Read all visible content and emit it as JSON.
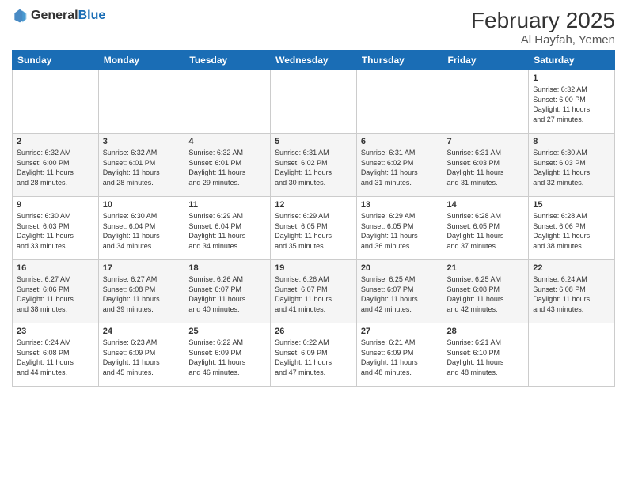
{
  "logo": {
    "text_general": "General",
    "text_blue": "Blue"
  },
  "header": {
    "month": "February 2025",
    "location": "Al Hayfah, Yemen"
  },
  "weekdays": [
    "Sunday",
    "Monday",
    "Tuesday",
    "Wednesday",
    "Thursday",
    "Friday",
    "Saturday"
  ],
  "weeks": [
    [
      {
        "day": "",
        "info": ""
      },
      {
        "day": "",
        "info": ""
      },
      {
        "day": "",
        "info": ""
      },
      {
        "day": "",
        "info": ""
      },
      {
        "day": "",
        "info": ""
      },
      {
        "day": "",
        "info": ""
      },
      {
        "day": "1",
        "info": "Sunrise: 6:32 AM\nSunset: 6:00 PM\nDaylight: 11 hours\nand 27 minutes."
      }
    ],
    [
      {
        "day": "2",
        "info": "Sunrise: 6:32 AM\nSunset: 6:00 PM\nDaylight: 11 hours\nand 28 minutes."
      },
      {
        "day": "3",
        "info": "Sunrise: 6:32 AM\nSunset: 6:01 PM\nDaylight: 11 hours\nand 28 minutes."
      },
      {
        "day": "4",
        "info": "Sunrise: 6:32 AM\nSunset: 6:01 PM\nDaylight: 11 hours\nand 29 minutes."
      },
      {
        "day": "5",
        "info": "Sunrise: 6:31 AM\nSunset: 6:02 PM\nDaylight: 11 hours\nand 30 minutes."
      },
      {
        "day": "6",
        "info": "Sunrise: 6:31 AM\nSunset: 6:02 PM\nDaylight: 11 hours\nand 31 minutes."
      },
      {
        "day": "7",
        "info": "Sunrise: 6:31 AM\nSunset: 6:03 PM\nDaylight: 11 hours\nand 31 minutes."
      },
      {
        "day": "8",
        "info": "Sunrise: 6:30 AM\nSunset: 6:03 PM\nDaylight: 11 hours\nand 32 minutes."
      }
    ],
    [
      {
        "day": "9",
        "info": "Sunrise: 6:30 AM\nSunset: 6:03 PM\nDaylight: 11 hours\nand 33 minutes."
      },
      {
        "day": "10",
        "info": "Sunrise: 6:30 AM\nSunset: 6:04 PM\nDaylight: 11 hours\nand 34 minutes."
      },
      {
        "day": "11",
        "info": "Sunrise: 6:29 AM\nSunset: 6:04 PM\nDaylight: 11 hours\nand 34 minutes."
      },
      {
        "day": "12",
        "info": "Sunrise: 6:29 AM\nSunset: 6:05 PM\nDaylight: 11 hours\nand 35 minutes."
      },
      {
        "day": "13",
        "info": "Sunrise: 6:29 AM\nSunset: 6:05 PM\nDaylight: 11 hours\nand 36 minutes."
      },
      {
        "day": "14",
        "info": "Sunrise: 6:28 AM\nSunset: 6:05 PM\nDaylight: 11 hours\nand 37 minutes."
      },
      {
        "day": "15",
        "info": "Sunrise: 6:28 AM\nSunset: 6:06 PM\nDaylight: 11 hours\nand 38 minutes."
      }
    ],
    [
      {
        "day": "16",
        "info": "Sunrise: 6:27 AM\nSunset: 6:06 PM\nDaylight: 11 hours\nand 38 minutes."
      },
      {
        "day": "17",
        "info": "Sunrise: 6:27 AM\nSunset: 6:08 PM\nDaylight: 11 hours\nand 39 minutes."
      },
      {
        "day": "18",
        "info": "Sunrise: 6:26 AM\nSunset: 6:07 PM\nDaylight: 11 hours\nand 40 minutes."
      },
      {
        "day": "19",
        "info": "Sunrise: 6:26 AM\nSunset: 6:07 PM\nDaylight: 11 hours\nand 41 minutes."
      },
      {
        "day": "20",
        "info": "Sunrise: 6:25 AM\nSunset: 6:07 PM\nDaylight: 11 hours\nand 42 minutes."
      },
      {
        "day": "21",
        "info": "Sunrise: 6:25 AM\nSunset: 6:08 PM\nDaylight: 11 hours\nand 42 minutes."
      },
      {
        "day": "22",
        "info": "Sunrise: 6:24 AM\nSunset: 6:08 PM\nDaylight: 11 hours\nand 43 minutes."
      }
    ],
    [
      {
        "day": "23",
        "info": "Sunrise: 6:24 AM\nSunset: 6:08 PM\nDaylight: 11 hours\nand 44 minutes."
      },
      {
        "day": "24",
        "info": "Sunrise: 6:23 AM\nSunset: 6:09 PM\nDaylight: 11 hours\nand 45 minutes."
      },
      {
        "day": "25",
        "info": "Sunrise: 6:22 AM\nSunset: 6:09 PM\nDaylight: 11 hours\nand 46 minutes."
      },
      {
        "day": "26",
        "info": "Sunrise: 6:22 AM\nSunset: 6:09 PM\nDaylight: 11 hours\nand 47 minutes."
      },
      {
        "day": "27",
        "info": "Sunrise: 6:21 AM\nSunset: 6:09 PM\nDaylight: 11 hours\nand 48 minutes."
      },
      {
        "day": "28",
        "info": "Sunrise: 6:21 AM\nSunset: 6:10 PM\nDaylight: 11 hours\nand 48 minutes."
      },
      {
        "day": "",
        "info": ""
      }
    ]
  ]
}
